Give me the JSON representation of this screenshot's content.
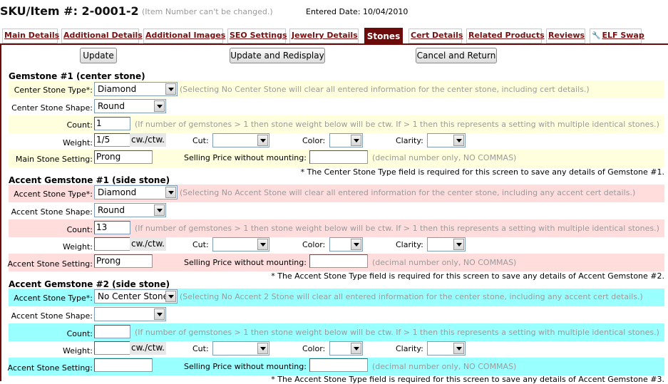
{
  "header": {
    "sku_title": "SKU/Item #: 2-0001-2",
    "sku_note": "(Item Number can't be changed.)",
    "entered_date": "Entered Date: 10/04/2010"
  },
  "tabs": [
    {
      "label": "Main Details"
    },
    {
      "label": "Additional Details"
    },
    {
      "label": "Additional Images"
    },
    {
      "label": "SEO Settings"
    },
    {
      "label": "Jewelry Details"
    },
    {
      "label": "Stones",
      "active": true
    },
    {
      "label": "Cert Details"
    },
    {
      "label": "Related Products"
    },
    {
      "label": "Reviews"
    },
    {
      "label": "ELF Swap",
      "icon": "wrench-icon"
    }
  ],
  "buttons": {
    "update": "Update",
    "update_redisplay": "Update and Redisplay",
    "cancel_return": "Cancel and Return"
  },
  "colors": {
    "accent": "#6d0a0a",
    "band_yellow": "#ffffdd",
    "band_pink": "#ffdddd",
    "band_cyan": "#99ffff",
    "help_text": "#9a9a9a"
  },
  "sections": [
    {
      "title": "Gemstone #1 (center stone)",
      "type_label": "Center Stone Type*:",
      "type_value": "Diamond",
      "type_help": "(Selecting No Center Stone will clear all entered information for the center stone, including cert details.)",
      "shape_label": "Center Stone Shape:",
      "shape_value": "Round",
      "count_label": "Count:",
      "count_value": "1",
      "count_help": "(If number of gemstones > 1 then stone weight below will be ctw. If > 1 then this represents a setting with multiple identical stones.)",
      "weight_label": "Weight:",
      "weight_value": "1/5",
      "weight_unit": "cw./ctw.",
      "cut_label": "Cut:",
      "cut_value": "",
      "color_label": "Color:",
      "color_value": "",
      "clarity_label": "Clarity:",
      "clarity_value": "",
      "setting_label": "Main Stone Setting:",
      "setting_value": "Prong",
      "price_label": "Selling Price without mounting:",
      "price_value": "",
      "price_help": "(decimal number only, NO COMMAS)",
      "required_note": "* The Center Stone Type field is required for this screen to save any details of Gemstone #1."
    },
    {
      "title": "Accent Gemstone #1 (side stone)",
      "type_label": "Accent Stone Type*:",
      "type_value": "Diamond",
      "type_help": "(Selecting No Accent Stone will clear all entered information for the center stone, including any accent cert details.)",
      "shape_label": "Accent Stone Shape:",
      "shape_value": "Round",
      "count_label": "Count:",
      "count_value": "13",
      "count_help": "(If number of gemstones > 1 then stone weight below will be ctw. If > 1 then this represents a setting with multiple identical stones.)",
      "weight_label": "Weight:",
      "weight_value": "",
      "weight_unit": "cw./ctw.",
      "cut_label": "Cut:",
      "cut_value": "",
      "color_label": "Color:",
      "color_value": "",
      "clarity_label": "Clarity:",
      "clarity_value": "",
      "setting_label": "Accent Stone Setting:",
      "setting_value": "Prong",
      "price_label": "Selling Price without mounting:",
      "price_value": "",
      "price_help": "(decimal number only, NO COMMAS)",
      "required_note": "* The Accent Stone Type field is required for this screen to save any details of Accent Gemstone #2."
    },
    {
      "title": "Accent Gemstone #2 (side stone)",
      "type_label": "Accent Stone Type*:",
      "type_value": "No Center Stone",
      "type_help": "(Selecting No Accent 2 Stone will clear all entered information for the center stone, including any accent cert details.)",
      "shape_label": "Accent Stone Shape:",
      "shape_value": "",
      "count_label": "Count:",
      "count_value": "",
      "count_help": "(If number of gemstones > 1 then stone weight below will be ctw. If > 1 then this represents a setting with multiple identical stones.)",
      "weight_label": "Weight:",
      "weight_value": "",
      "weight_unit": "cw./ctw.",
      "cut_label": "Cut:",
      "cut_value": "",
      "color_label": "Color:",
      "color_value": "",
      "clarity_label": "Clarity:",
      "clarity_value": "",
      "setting_label": "Accent Stone Setting:",
      "setting_value": "",
      "price_label": "Selling Price without mounting:",
      "price_value": "",
      "price_help": "(decimal number only, NO COMMAS)",
      "required_note": "* The Accent Stone Type field is required for this screen to save any details of Accent Gemstone #3."
    }
  ]
}
